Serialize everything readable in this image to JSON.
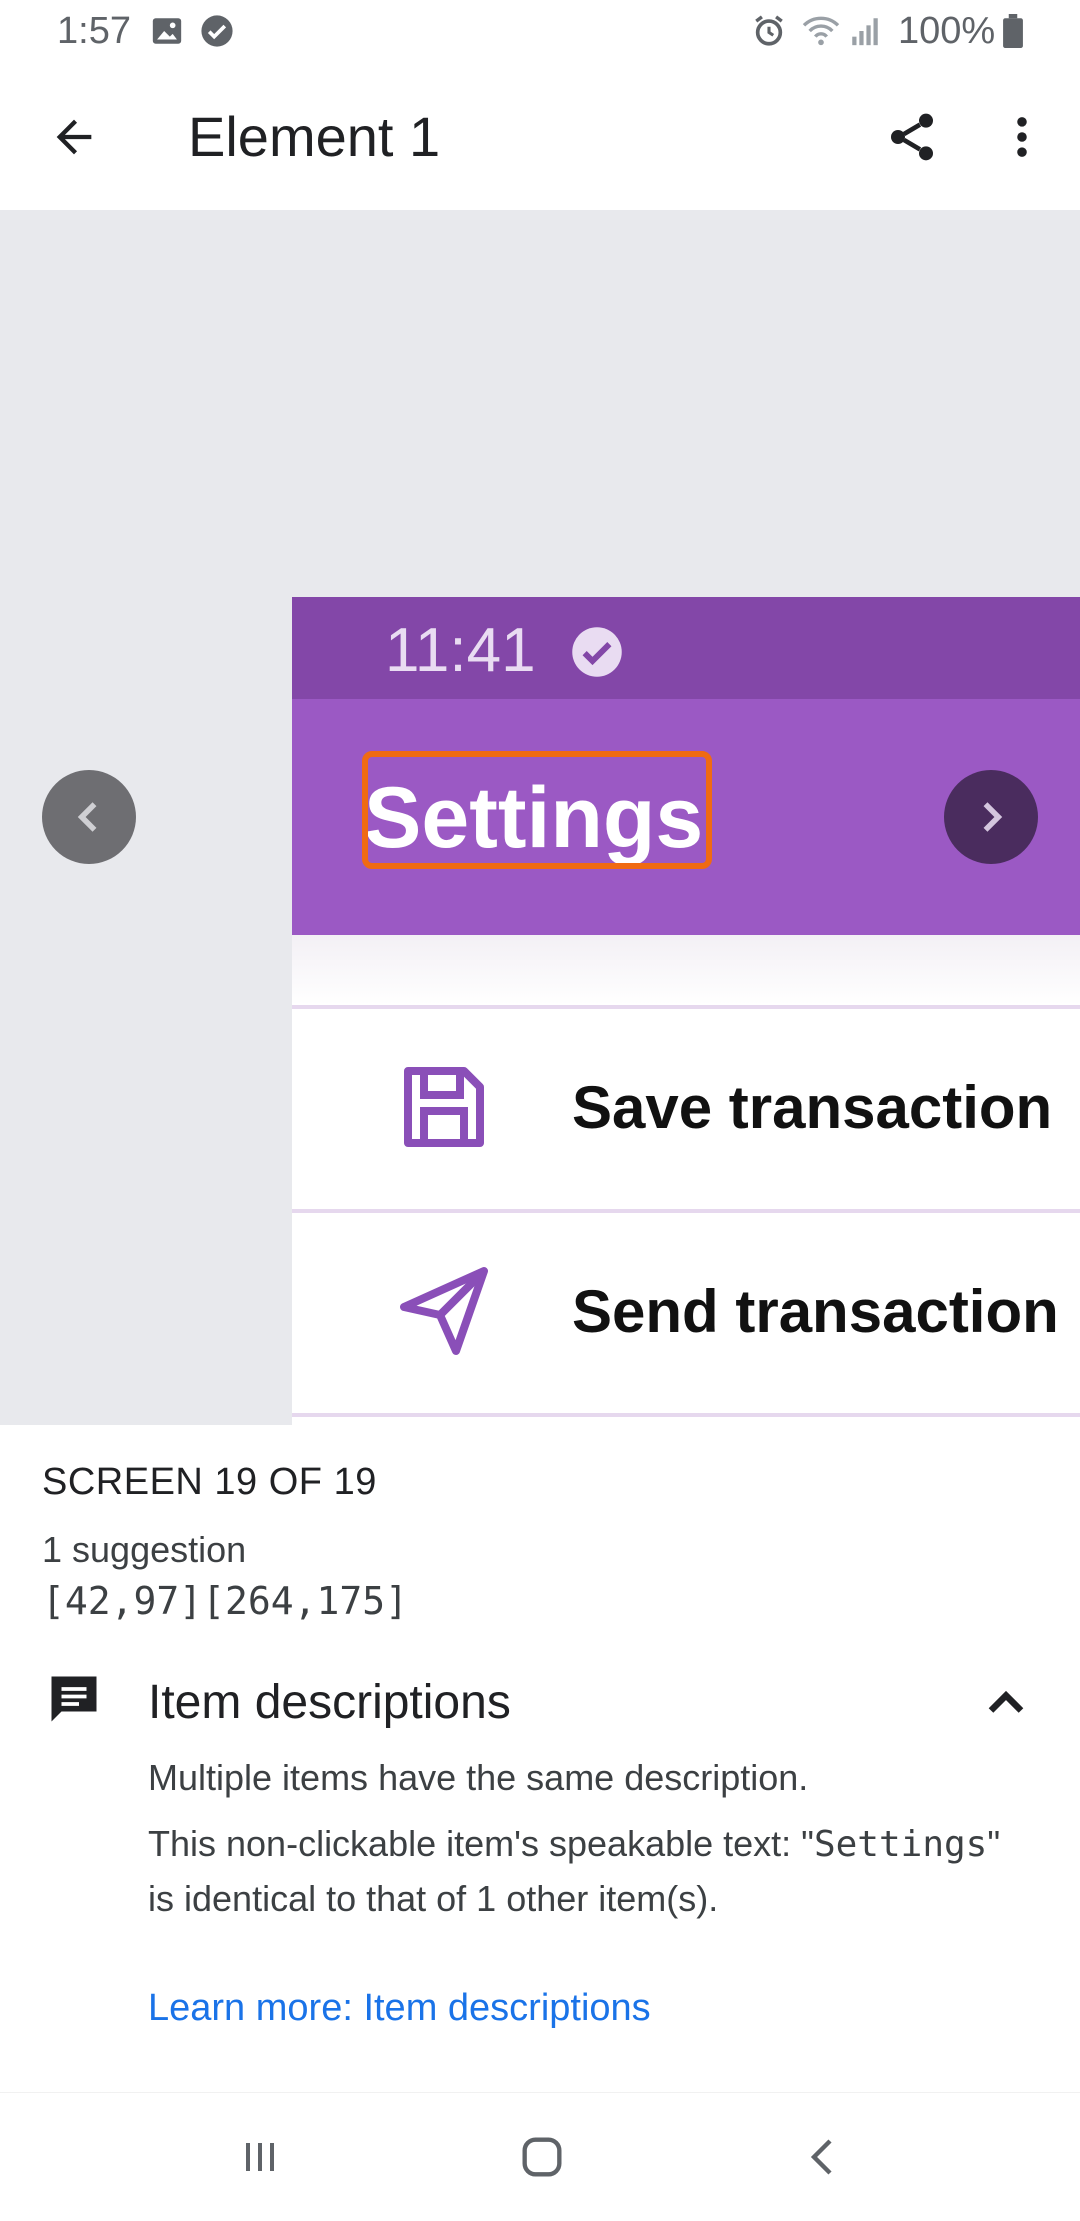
{
  "status_bar": {
    "time": "1:57",
    "battery": "100%",
    "icons": [
      "image-icon",
      "check-circle-icon",
      "alarm-icon",
      "wifi-icon",
      "signal-icon",
      "battery-icon"
    ]
  },
  "app_bar": {
    "title": "Element 1",
    "icons": [
      "back-arrow-icon",
      "share-icon",
      "more-vert-icon"
    ]
  },
  "preview": {
    "phone_time": "11:41",
    "phone_title": "Settings",
    "rows": [
      {
        "label": "Save transaction",
        "icon": "save-icon"
      },
      {
        "label": "Send transaction",
        "icon": "send-icon"
      }
    ],
    "accent": "#9b59c4",
    "highlight_color": "#f06a13"
  },
  "details": {
    "screen_counter": "SCREEN 19 OF 19",
    "suggestion_count": "1 suggestion",
    "coordinates": "[42,97][264,175]",
    "section_title": "Item descriptions",
    "summary": "Multiple items have the same description.",
    "detail_prefix": "This non-clickable item's speakable text: \"",
    "detail_code": "Settings",
    "detail_suffix": "\" is identical to that of 1 other item(s).",
    "learn_more": "Learn more: Item descriptions"
  },
  "bottom_nav": {
    "icons": [
      "recents-icon",
      "home-icon",
      "back-icon"
    ]
  }
}
